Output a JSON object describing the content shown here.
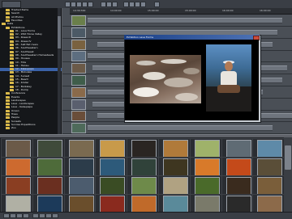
{
  "toolbar": {
    "zoom_label": "...",
    "icons": [
      "rewind-icon",
      "play-icon",
      "pause-icon",
      "stop-icon",
      "forward-icon",
      "prev-icon",
      "next-icon",
      "loop-icon",
      "cut-icon",
      "copy-icon",
      "paste-icon",
      "delete-icon",
      "settings-icon"
    ]
  },
  "timeline": {
    "ruler_ticks": [
      "14:30:300",
      "14:00:00",
      "15:00:00",
      "15:00:00",
      "16:00:00",
      "16:00:00"
    ],
    "row_count": 10
  },
  "tree": {
    "items": [
      {
        "label": "Trashed Items",
        "depth": 1,
        "selected": false
      },
      {
        "label": "Search",
        "depth": 1,
        "selected": false
      },
      {
        "label": "All Photos",
        "depth": 1,
        "selected": false
      },
      {
        "label": "Favorites",
        "depth": 1,
        "selected": false
      },
      {
        "label": "Data",
        "depth": 0,
        "selected": false
      },
      {
        "label": "Exhibitions",
        "depth": 1,
        "selected": false
      },
      {
        "label": "01 - Lava Forms",
        "depth": 2,
        "selected": false
      },
      {
        "label": "02 - Wild Horse Valley",
        "depth": 2,
        "selected": false
      },
      {
        "label": "03 - Roses III",
        "depth": 2,
        "selected": false
      },
      {
        "label": "04 - Roses IV",
        "depth": 2,
        "selected": false
      },
      {
        "label": "05 - Salt flat rivers",
        "depth": 2,
        "selected": false
      },
      {
        "label": "06 - Southwestern",
        "depth": 2,
        "selected": false
      },
      {
        "label": "07 - Southwest",
        "depth": 2,
        "selected": false
      },
      {
        "label": "08 - Southwestern Homesteads",
        "depth": 2,
        "selected": false
      },
      {
        "label": "09 - Houses",
        "depth": 2,
        "selected": false
      },
      {
        "label": "10 - Tide",
        "depth": 2,
        "selected": false
      },
      {
        "label": "11 - Hanau",
        "depth": 2,
        "selected": false
      },
      {
        "label": "12 - Kalaupapa",
        "depth": 2,
        "selected": true
      },
      {
        "label": "13 - Mokuleia",
        "depth": 2,
        "selected": false
      },
      {
        "label": "14 - Sunset",
        "depth": 2,
        "selected": false
      },
      {
        "label": "15 - Beach",
        "depth": 2,
        "selected": false
      },
      {
        "label": "16 - Kinder",
        "depth": 2,
        "selected": false
      },
      {
        "label": "17 - Barkeley",
        "depth": 2,
        "selected": false
      },
      {
        "label": "18 - Dump",
        "depth": 2,
        "selected": false
      },
      {
        "label": "Conference",
        "depth": 1,
        "selected": false
      },
      {
        "label": "Events",
        "depth": 1,
        "selected": false
      },
      {
        "label": "Landscapes",
        "depth": 1,
        "selected": false
      },
      {
        "label": "Lava - Landscapes",
        "depth": 1,
        "selected": false
      },
      {
        "label": "Lava - Kalaupapa",
        "depth": 1,
        "selected": false
      },
      {
        "label": "Ocean",
        "depth": 1,
        "selected": false
      },
      {
        "label": "Trees",
        "depth": 1,
        "selected": false
      },
      {
        "label": "People",
        "depth": 1,
        "selected": false
      },
      {
        "label": "Sunsets",
        "depth": 1,
        "selected": false
      },
      {
        "label": "Sunrise Expeditions",
        "depth": 1,
        "selected": false
      },
      {
        "label": "Zoo",
        "depth": 1,
        "selected": false
      }
    ]
  },
  "viewer": {
    "title": "Exhibition Lava Forms"
  },
  "grid": {
    "thumb_colors": [
      "#6b5a48",
      "#3f4a3a",
      "#7a6a50",
      "#c89a4a",
      "#2a2522",
      "#b07a3a",
      "#9fb26a",
      "#5f6b74",
      "#5e8aa8",
      "#cd6a2f",
      "#4e6b3a",
      "#2c3c4a",
      "#2d5a7a",
      "#30423a",
      "#3e3620",
      "#d87a2a",
      "#c44a1a",
      "#5a4e38",
      "#8a3e22",
      "#6a2f20",
      "#4c5c6e",
      "#3a4c24",
      "#6e8a4a",
      "#b0a282",
      "#4a6a2a",
      "#3a2b1e",
      "#7a5e3a",
      "#b0b0a4",
      "#1c3a5a",
      "#6a4e2c",
      "#8a2a1e",
      "#c06a2a",
      "#5a8a9a",
      "#7a7a6a",
      "#2a2a2a",
      "#8c6a4a"
    ]
  }
}
